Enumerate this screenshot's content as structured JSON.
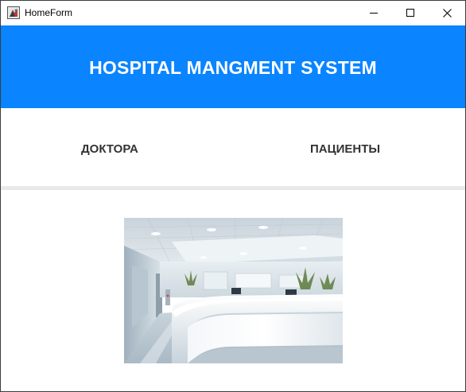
{
  "window": {
    "title": "HomeForm",
    "icon": "java-app-icon",
    "controls": [
      "minimize-icon",
      "maximize-icon",
      "close-icon"
    ]
  },
  "banner": {
    "title": "HOSPITAL MANGMENT SYSTEM",
    "background": "#0a84ff"
  },
  "nav": {
    "doctors_label": "ДОКТОРА",
    "patients_label": "ПАЦИЕНТЫ"
  },
  "content": {
    "image": "hospital-reception-photo"
  }
}
